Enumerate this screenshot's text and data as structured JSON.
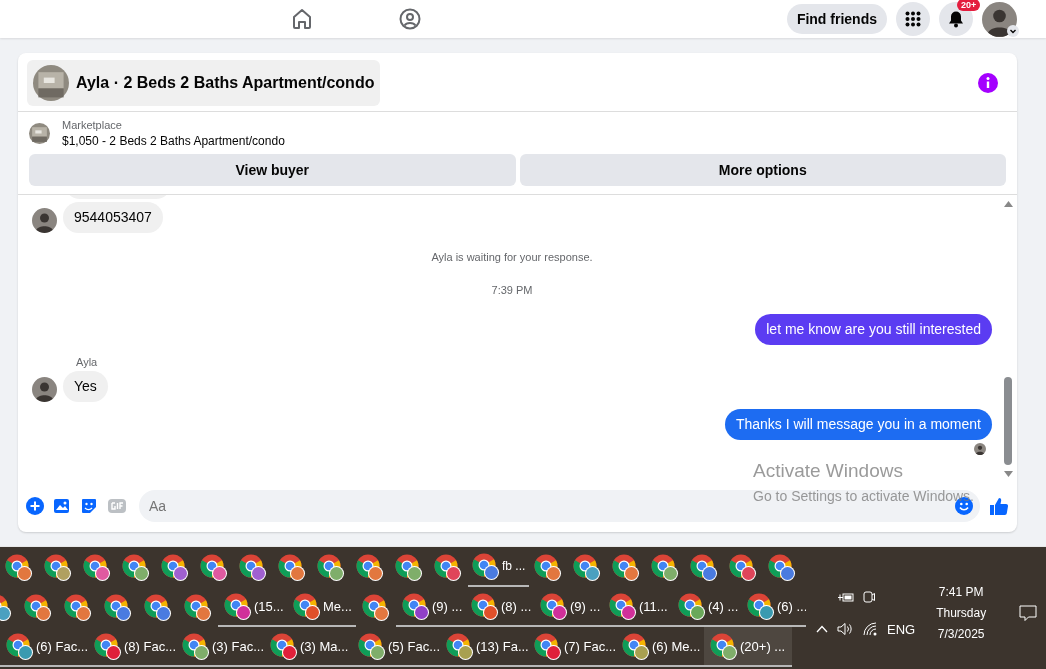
{
  "top_bar": {
    "find_friends": "Find friends",
    "notification_badge": "20+"
  },
  "chat": {
    "title": "Ayla · 2 Beds 2 Baths Apartment/condo",
    "listing": {
      "source": "Marketplace",
      "summary": "$1,050 - 2 Beds 2 Baths Apartment/condo"
    },
    "buttons": [
      "View buyer",
      "More options"
    ],
    "messages": [
      {
        "kind": "partial"
      },
      {
        "kind": "incoming",
        "text": "9544053407",
        "avatar": true
      },
      {
        "kind": "system",
        "text": "Ayla is waiting for your response."
      },
      {
        "kind": "timestamp",
        "text": "7:39 PM"
      },
      {
        "kind": "outgoing",
        "text": "let me know are you still interested",
        "color": "#5b3cf2"
      },
      {
        "kind": "sender",
        "text": "Ayla"
      },
      {
        "kind": "incoming",
        "text": "Yes",
        "avatar": true
      },
      {
        "kind": "outgoing",
        "text": "Thanks I will message you in a moment",
        "color": "#1d6cf2"
      },
      {
        "kind": "seen"
      }
    ],
    "composer": {
      "placeholder": "Aa"
    }
  },
  "activation_notice": {
    "title": "Activate Windows",
    "text": "Go to Settings to activate Windows."
  },
  "taskbar": {
    "groups": [
      {
        "buttons": [
          {
            "color": "#e2773f",
            "selected": false
          },
          {
            "color": "#b0a060",
            "selected": false
          },
          {
            "color": "#e05aa0",
            "selected": false
          },
          {
            "color": "#7fae6a",
            "selected": false
          },
          {
            "color": "#a060d0",
            "selected": false
          },
          {
            "color": "#e05aa0",
            "selected": false
          },
          {
            "color": "#a060d0",
            "selected": false
          },
          {
            "color": "#e2773f",
            "selected": false
          },
          {
            "color": "#7fae6a",
            "selected": false
          },
          {
            "color": "#e2773f",
            "selected": false
          },
          {
            "color": "#7fae6a",
            "selected": false
          },
          {
            "color": "#e0455a",
            "selected": false
          },
          {
            "color": "#4a7be0",
            "label": "fb ...",
            "selected": false
          },
          {
            "color": "#e2773f",
            "selected": false
          },
          {
            "color": "#4aa0c0",
            "selected": false
          },
          {
            "color": "#e2773f",
            "selected": false
          },
          {
            "color": "#7fae6a",
            "selected": false
          },
          {
            "color": "#4a7be0",
            "selected": false
          },
          {
            "color": "#e0455a",
            "selected": false
          },
          {
            "color": "#4a7be0",
            "selected": false
          }
        ]
      },
      {
        "buttons": [
          {
            "color": "#4aa0c0",
            "selected": false
          },
          {
            "color": "#e2773f",
            "selected": false
          },
          {
            "color": "#e2773f",
            "selected": false
          },
          {
            "color": "#4a7be0",
            "selected": false
          },
          {
            "color": "#4a7be0",
            "selected": false
          },
          {
            "color": "#e2773f",
            "selected": false
          },
          {
            "color": "#d0309a",
            "label": "(15...",
            "selected": false
          },
          {
            "color": "#e0502a",
            "label": "Me...",
            "selected": false
          },
          {
            "color": "#e2773f",
            "selected": false
          },
          {
            "color": "#9040c8",
            "label": "(9) ...",
            "selected": false
          },
          {
            "color": "#e0502a",
            "label": "(8) ...",
            "selected": false
          },
          {
            "color": "#d0309a",
            "label": "(9) ...",
            "selected": false
          },
          {
            "color": "#d0309a",
            "label": "(11...",
            "selected": false
          },
          {
            "color": "#6aa85a",
            "label": "(4) ...",
            "selected": false
          },
          {
            "color": "#3a9ab0",
            "label": "(6) ...",
            "selected": false
          }
        ]
      },
      {
        "buttons": [
          {
            "color": "#3a9ab0",
            "label": "(6) Fac...",
            "selected": false
          },
          {
            "color": "#e0203a",
            "label": "(8) Fac...",
            "selected": false
          },
          {
            "color": "#7fae6a",
            "label": "(3) Fac...",
            "selected": false
          },
          {
            "color": "#e0203a",
            "label": "(3) Ma...",
            "selected": false
          },
          {
            "color": "#7fae6a",
            "label": "(5) Fac...",
            "selected": false
          },
          {
            "color": "#a8a050",
            "label": "(13) Fa...",
            "selected": false
          },
          {
            "color": "#e0203a",
            "label": "(7) Fac...",
            "selected": false
          },
          {
            "color": "#a8a050",
            "label": "(6) Me...",
            "selected": false
          },
          {
            "color": "#7fae6a",
            "label": "(20+) ...",
            "selected": true
          }
        ]
      }
    ],
    "language": "ENG",
    "time": "7:41 PM",
    "day": "Thursday",
    "date": "7/3/2025"
  }
}
